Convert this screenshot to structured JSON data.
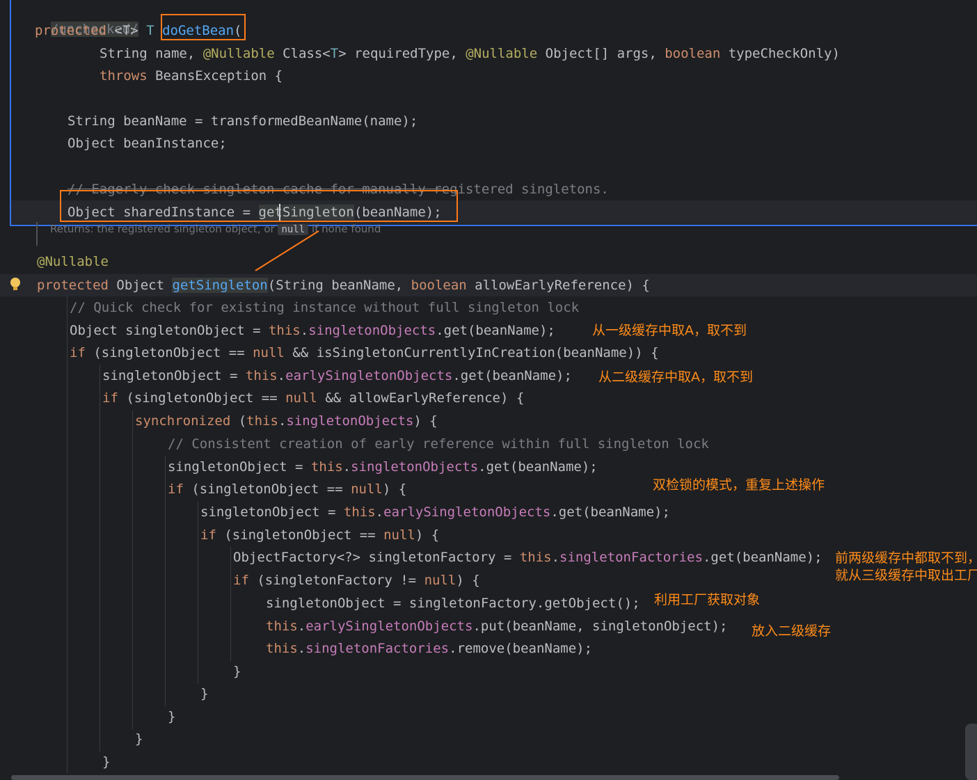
{
  "doGetBean": {
    "l0": "/unchecked/",
    "l1": {
      "kw": "protected",
      "generic": "<T>",
      "ret": "T",
      "name": "doGetBean",
      "open": "("
    },
    "l2": {
      "pre": "String name, ",
      "ann1": "@Nullable",
      "mid1": " Class<",
      "tp": "T",
      "mid2": "> requiredType, ",
      "ann2": "@Nullable",
      "mid3": " Object[] args, ",
      "kw": "boolean",
      "post": " typeCheckOnly)"
    },
    "l3": {
      "kw": "throws",
      "post": " BeansException {"
    },
    "l4": "String beanName = transformedBeanName(name);",
    "l5": "Object beanInstance;",
    "l6": {
      "strike": "// Eagerly check singleton cache for manually r",
      "rest": "egistered singletons."
    },
    "l7": {
      "pre": "Object sharedInstance = ",
      "call": "getSingleton",
      "post": "(beanName);"
    },
    "doc": {
      "pre": "Returns: the registered singleton object, or ",
      "null": "null",
      "post": " if none found"
    }
  },
  "getSingleton": {
    "ann": "@Nullable",
    "sig": {
      "kw": "protected",
      "ret": " Object ",
      "name": "getSingleton",
      "p1": "(String beanName, ",
      "kw2": "boolean",
      "p2": " allowEarlyReference) {"
    },
    "c1": "// Quick check for existing instance without full singleton lock",
    "s1": {
      "pre": "Object singletonObject = ",
      "this": "this",
      "dot": ".",
      "fld": "singletonObjects",
      "post": ".get(beanName);"
    },
    "s2": {
      "kw": "if",
      "pre": " (singletonObject == ",
      "null": "null",
      "post": " && isSingletonCurrentlyInCreation(beanName)) {"
    },
    "s3": {
      "pre": "singletonObject = ",
      "this": "this",
      "dot": ".",
      "fld": "earlySingletonObjects",
      "post": ".get(beanName);"
    },
    "s4": {
      "kw": "if",
      "pre": " (singletonObject == ",
      "null": "null",
      "post": " && allowEarlyReference) {"
    },
    "s5": {
      "kw": "synchronized",
      "pre": " (",
      "this": "this",
      "dot": ".",
      "fld": "singletonObjects",
      "post": ") {"
    },
    "c2": "// Consistent creation of early reference within full singleton lock",
    "s6": {
      "pre": "singletonObject = ",
      "this": "this",
      "dot": ".",
      "fld": "singletonObjects",
      "post": ".get(beanName);"
    },
    "s7": {
      "kw": "if",
      "pre": " (singletonObject == ",
      "null": "null",
      "post": ") {"
    },
    "s8": {
      "pre": "singletonObject = ",
      "this": "this",
      "dot": ".",
      "fld": "earlySingletonObjects",
      "post": ".get(beanName);"
    },
    "s9": {
      "kw": "if",
      "pre": " (singletonObject == ",
      "null": "null",
      "post": ") {"
    },
    "s10": {
      "pre": "ObjectFactory<?> singletonFactory = ",
      "this": "this",
      "dot": ".",
      "fld": "singletonFactories",
      "post": ".get(beanName);"
    },
    "s11": {
      "kw": "if",
      "pre": " (singletonFactory != ",
      "null": "null",
      "post": ") {"
    },
    "s12": "singletonObject = singletonFactory.getObject();",
    "s13": {
      "this": "this",
      "dot": ".",
      "fld": "earlySingletonObjects",
      "post": ".put(beanName, singletonObject);"
    },
    "s14": {
      "this": "this",
      "dot": ".",
      "fld": "singletonFactories",
      "post": ".remove(beanName);"
    },
    "brace": "}"
  },
  "notes": {
    "n1": "从一级缓存中取A，取不到",
    "n2": "从二级缓存中取A，取不到",
    "n3": "双检锁的模式，重复上述操作",
    "n4a": "前两级缓存中都取不到，",
    "n4b": "就从三级缓存中取出工厂",
    "n5": "利用工厂获取对象",
    "n6": "放入二级缓存"
  },
  "colors": {
    "annotation": "#ff7a1a",
    "keyword": "#cf8e6d",
    "field": "#c77dbb",
    "method": "#56a8f5",
    "background": "#1e1f22"
  }
}
